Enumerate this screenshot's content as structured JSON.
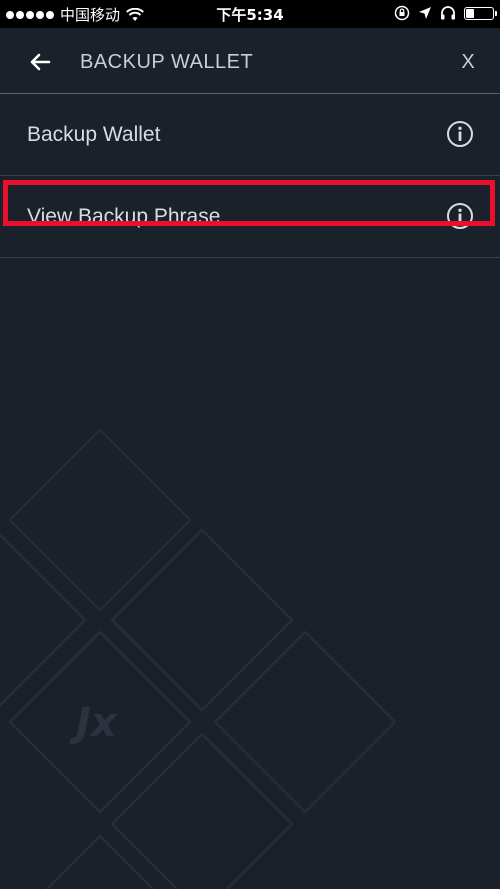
{
  "status_bar": {
    "carrier": "中国移动",
    "time": "下午5:34",
    "icons": [
      "signal-dots-icon",
      "wifi-icon",
      "rotation-lock-icon",
      "location-icon",
      "headphones-icon",
      "battery-icon"
    ]
  },
  "header": {
    "back_icon": "arrow-left-icon",
    "title": "BACKUP WALLET",
    "close_label": "X"
  },
  "menu": {
    "items": [
      {
        "label": "Backup Wallet",
        "icon": "info-icon"
      },
      {
        "label": "View Backup Phrase",
        "icon": "info-icon"
      }
    ]
  },
  "watermark": {
    "logo_text": "Jx"
  },
  "colors": {
    "background": "#1b212a",
    "highlight": "#e8102c",
    "text": "#d8dce2",
    "divider": "#3a414c"
  }
}
